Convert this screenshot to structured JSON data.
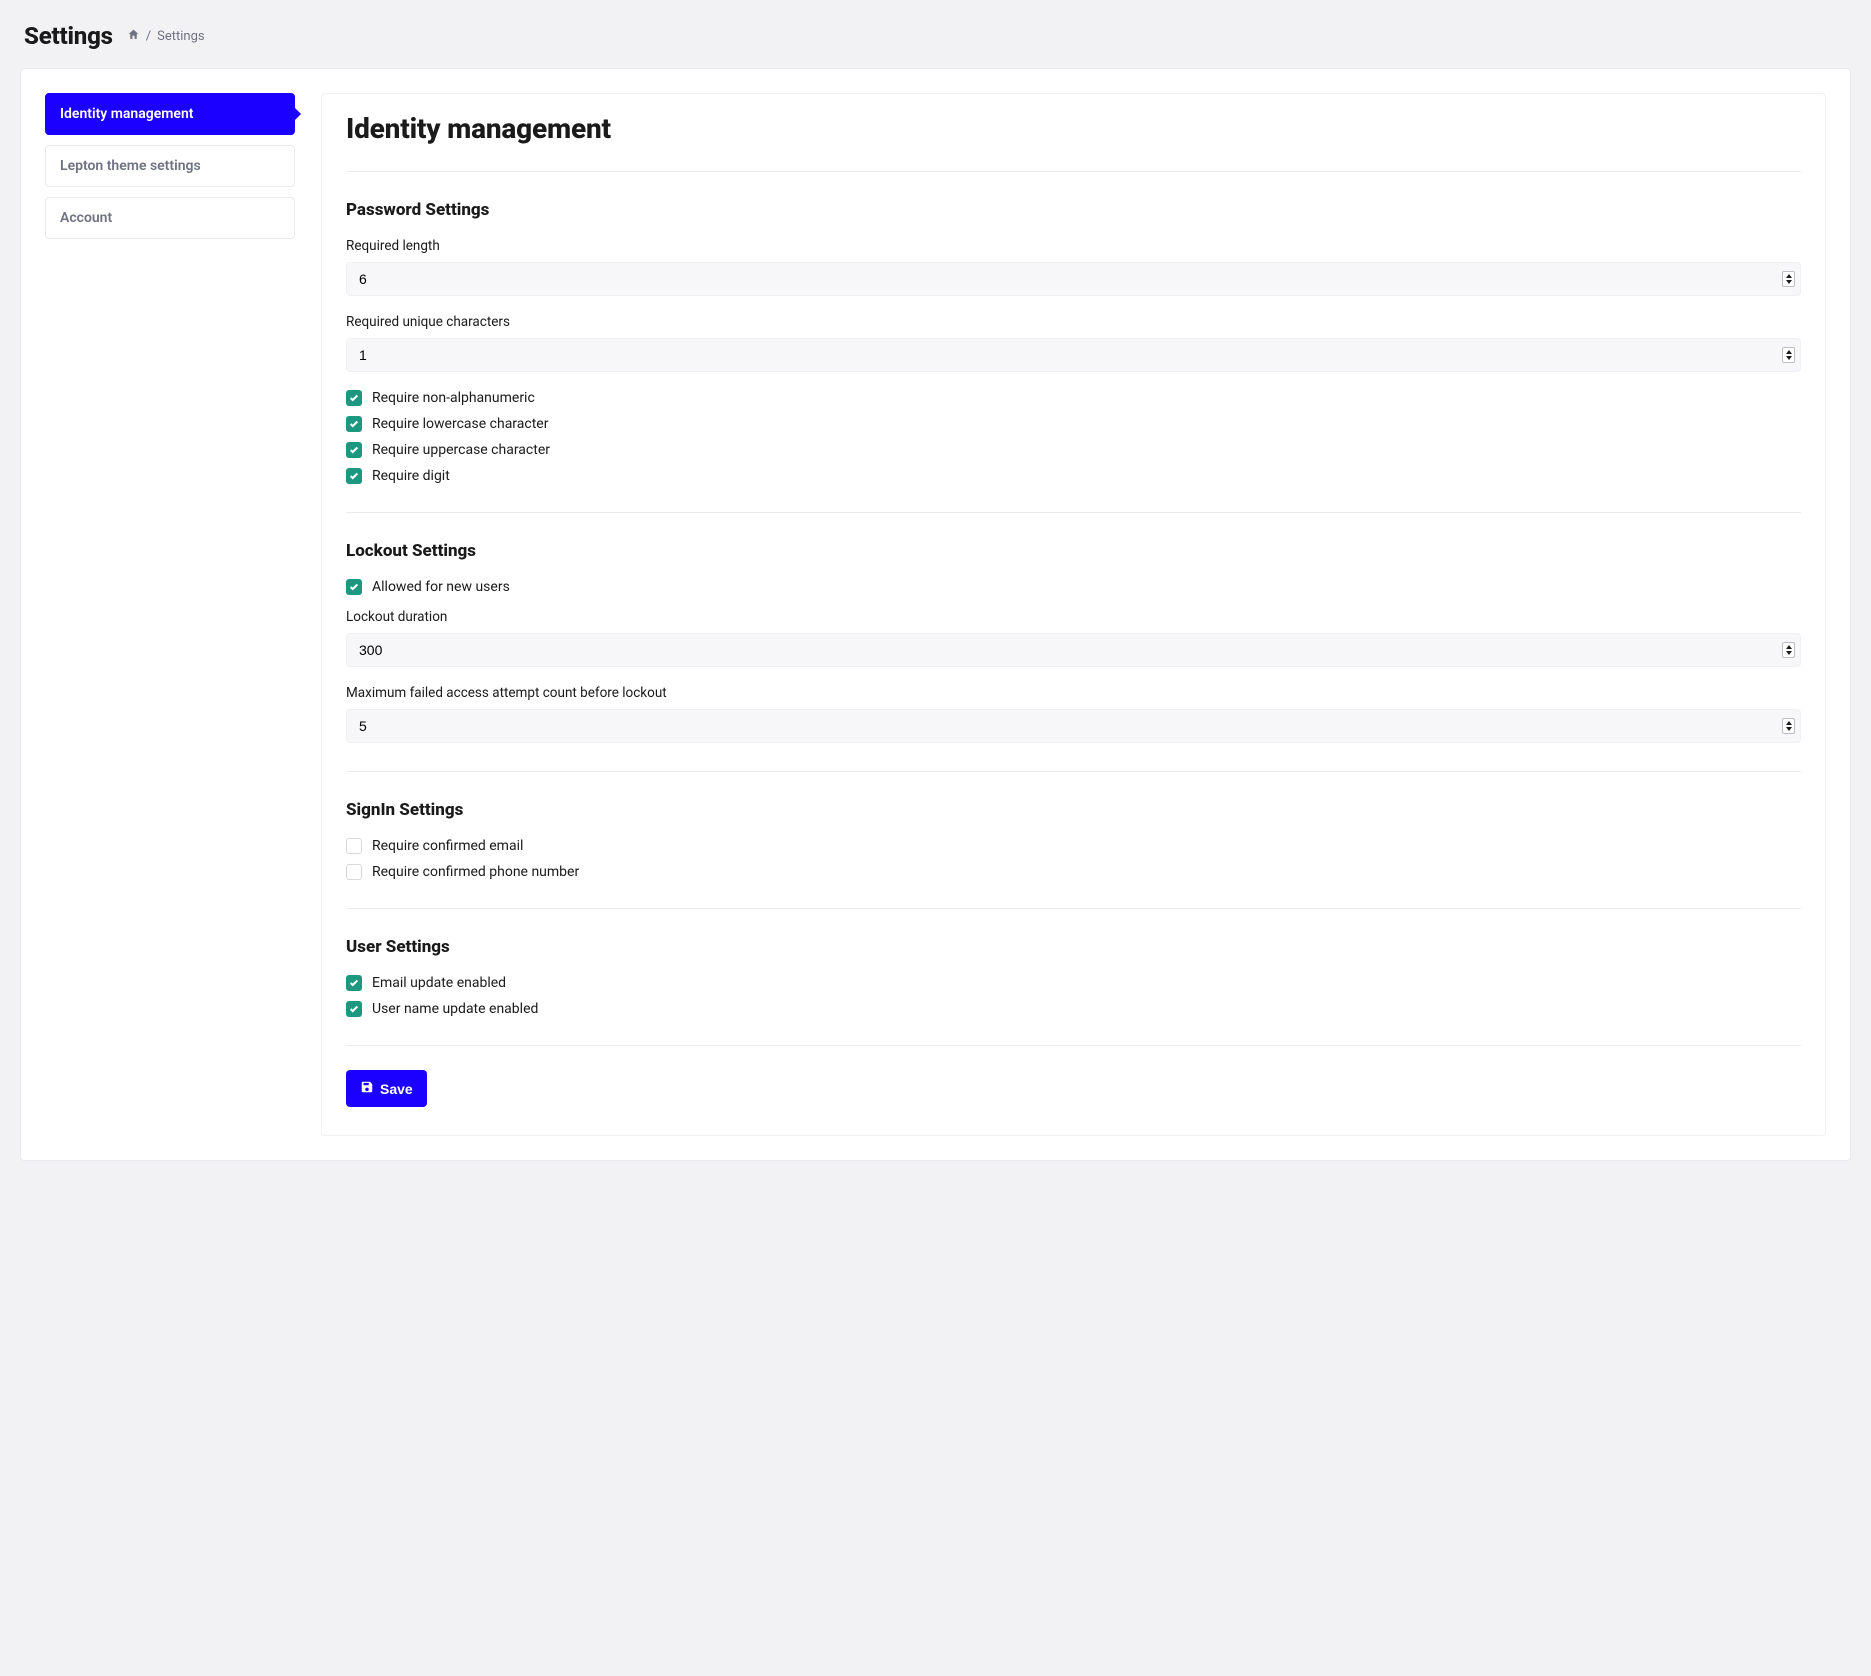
{
  "header": {
    "title": "Settings",
    "breadcrumb_sep": "/",
    "breadcrumb_current": "Settings"
  },
  "sidebar": {
    "tabs": [
      {
        "label": "Identity management",
        "active": true
      },
      {
        "label": "Lepton theme settings",
        "active": false
      },
      {
        "label": "Account",
        "active": false
      }
    ]
  },
  "main": {
    "title": "Identity management",
    "sections": {
      "password": {
        "heading": "Password Settings",
        "required_length_label": "Required length",
        "required_length_value": "6",
        "unique_chars_label": "Required unique characters",
        "unique_chars_value": "1",
        "checks": {
          "nonalpha": "Require non-alphanumeric",
          "lowercase": "Require lowercase character",
          "uppercase": "Require uppercase character",
          "digit": "Require digit"
        }
      },
      "lockout": {
        "heading": "Lockout Settings",
        "allowed_new_users": "Allowed for new users",
        "duration_label": "Lockout duration",
        "duration_value": "300",
        "max_failed_label": "Maximum failed access attempt count before lockout",
        "max_failed_value": "5"
      },
      "signin": {
        "heading": "SignIn Settings",
        "confirmed_email": "Require confirmed email",
        "confirmed_phone": "Require confirmed phone number"
      },
      "user": {
        "heading": "User Settings",
        "email_update": "Email update enabled",
        "username_update": "User name update enabled"
      }
    },
    "save_label": "Save"
  }
}
